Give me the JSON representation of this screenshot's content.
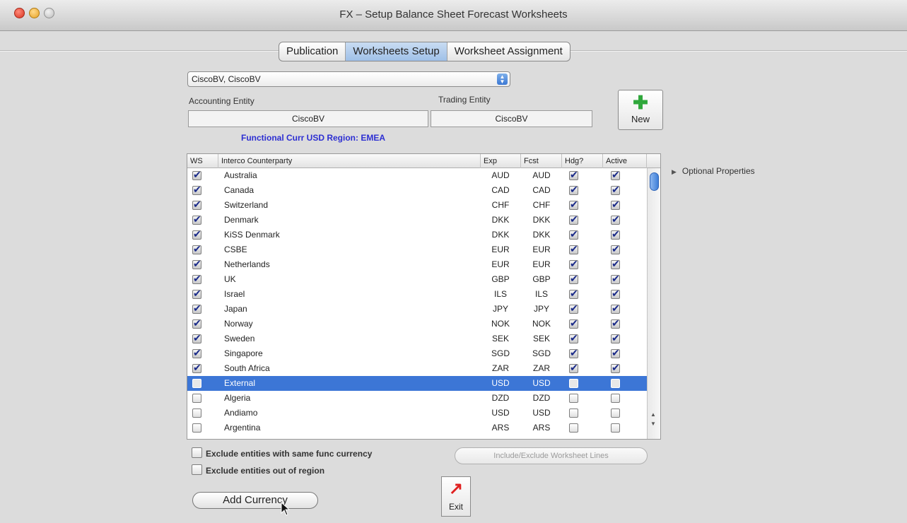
{
  "window": {
    "title": "FX – Setup Balance Sheet Forecast Worksheets"
  },
  "tabs": [
    {
      "label": "Publication",
      "active": false
    },
    {
      "label": "Worksheets Setup",
      "active": true
    },
    {
      "label": "Worksheet Assignment",
      "active": false
    }
  ],
  "entity_select": {
    "value": "CiscoBV,  CiscoBV"
  },
  "accounting_entity": {
    "label": "Accounting Entity",
    "value": "CiscoBV"
  },
  "trading_entity": {
    "label": "Trading Entity",
    "value": "CiscoBV"
  },
  "new_button": {
    "label": "New"
  },
  "functional_info": "Functional Curr USD  Region: EMEA",
  "table": {
    "headers": {
      "ws": "WS",
      "name": "Interco Counterparty",
      "exp": "Exp",
      "fcst": "Fcst",
      "hdg": "Hdg?",
      "active": "Active"
    },
    "rows": [
      {
        "ws": true,
        "name": "Australia",
        "exp": "AUD",
        "fcst": "AUD",
        "hdg": true,
        "active": true
      },
      {
        "ws": true,
        "name": "Canada",
        "exp": "CAD",
        "fcst": "CAD",
        "hdg": true,
        "active": true
      },
      {
        "ws": true,
        "name": "Switzerland",
        "exp": "CHF",
        "fcst": "CHF",
        "hdg": true,
        "active": true
      },
      {
        "ws": true,
        "name": "Denmark",
        "exp": "DKK",
        "fcst": "DKK",
        "hdg": true,
        "active": true
      },
      {
        "ws": true,
        "name": "KiSS Denmark",
        "exp": "DKK",
        "fcst": "DKK",
        "hdg": true,
        "active": true
      },
      {
        "ws": true,
        "name": "CSBE",
        "exp": "EUR",
        "fcst": "EUR",
        "hdg": true,
        "active": true
      },
      {
        "ws": true,
        "name": "Netherlands",
        "exp": "EUR",
        "fcst": "EUR",
        "hdg": true,
        "active": true
      },
      {
        "ws": true,
        "name": "UK",
        "exp": "GBP",
        "fcst": "GBP",
        "hdg": true,
        "active": true
      },
      {
        "ws": true,
        "name": "Israel",
        "exp": "ILS",
        "fcst": "ILS",
        "hdg": true,
        "active": true
      },
      {
        "ws": true,
        "name": "Japan",
        "exp": "JPY",
        "fcst": "JPY",
        "hdg": true,
        "active": true
      },
      {
        "ws": true,
        "name": "Norway",
        "exp": "NOK",
        "fcst": "NOK",
        "hdg": true,
        "active": true
      },
      {
        "ws": true,
        "name": "Sweden",
        "exp": "SEK",
        "fcst": "SEK",
        "hdg": true,
        "active": true
      },
      {
        "ws": true,
        "name": "Singapore",
        "exp": "SGD",
        "fcst": "SGD",
        "hdg": true,
        "active": true
      },
      {
        "ws": true,
        "name": "South Africa",
        "exp": "ZAR",
        "fcst": "ZAR",
        "hdg": true,
        "active": true
      },
      {
        "ws": false,
        "name": "External",
        "exp": "USD",
        "fcst": "USD",
        "hdg": false,
        "active": false,
        "selected": true
      },
      {
        "ws": false,
        "name": "Algeria",
        "exp": "DZD",
        "fcst": "DZD",
        "hdg": false,
        "active": false
      },
      {
        "ws": false,
        "name": "Andiamo",
        "exp": "USD",
        "fcst": "USD",
        "hdg": false,
        "active": false
      },
      {
        "ws": false,
        "name": "Argentina",
        "exp": "ARS",
        "fcst": "ARS",
        "hdg": false,
        "active": false
      }
    ]
  },
  "optional_properties": {
    "label": "Optional Properties"
  },
  "exclude_same_currency": {
    "label": "Exclude entities with same func currency",
    "checked": false
  },
  "exclude_out_of_region": {
    "label": "Exclude entities out of region",
    "checked": false
  },
  "include_exclude_button": {
    "label": "Include/Exclude Worksheet Lines"
  },
  "add_currency_button": {
    "label": "Add Currency"
  },
  "exit_button": {
    "label": "Exit"
  },
  "colors": {
    "selection": "#3c76d6",
    "functional_text": "#2d2fd2",
    "new_plus": "#2fa73b",
    "exit_arrow": "#e02020"
  }
}
